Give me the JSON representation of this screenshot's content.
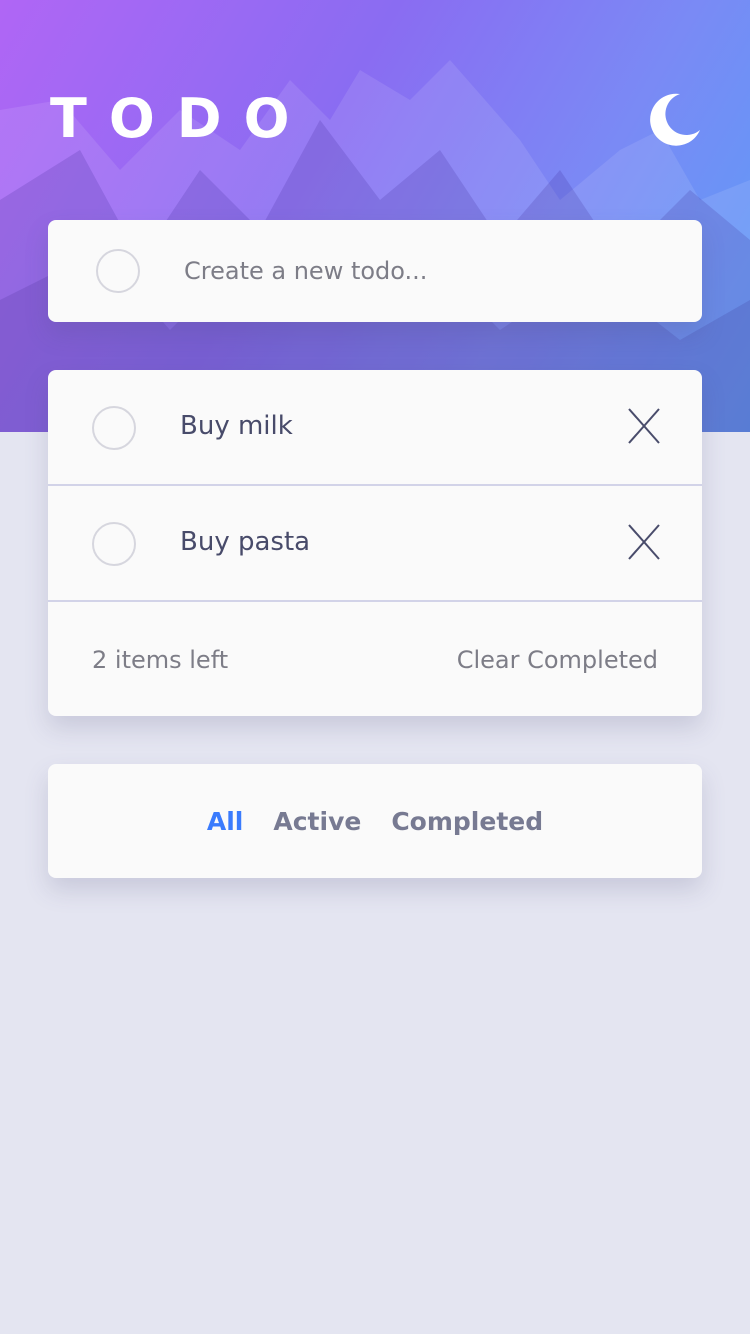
{
  "app": {
    "title": "TODO",
    "accent_color": "#3a7bfd",
    "theme_icon": "moon-icon"
  },
  "new_todo": {
    "placeholder": "Create a new todo..."
  },
  "todos": [
    {
      "text": "Buy milk",
      "completed": false,
      "delete_icon": "close-icon"
    },
    {
      "text": "Buy pasta",
      "completed": false,
      "delete_icon": "close-icon"
    }
  ],
  "footer": {
    "items_left": "2 items left",
    "clear_completed": "Clear Completed"
  },
  "filters": {
    "all": "All",
    "active": "Active",
    "completed": "Completed",
    "selected": "All"
  }
}
